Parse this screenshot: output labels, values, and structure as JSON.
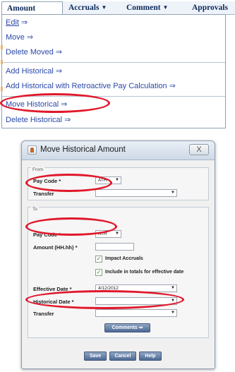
{
  "menubar": {
    "tabs": [
      {
        "label": "Amount",
        "has_caret": false
      },
      {
        "label": "Accruals",
        "caret": "▼"
      },
      {
        "label": "Comment",
        "caret": "▼"
      },
      {
        "label": "Approvals",
        "caret": ""
      }
    ]
  },
  "menu": {
    "arrow": "⇒",
    "items": [
      {
        "label": "Edit"
      },
      {
        "label": "Move"
      },
      {
        "label": "Delete Moved"
      },
      {
        "label": "Add Historical"
      },
      {
        "label": "Add Historical with Retroactive Pay Calculation"
      },
      {
        "label": "Move Historical"
      },
      {
        "label": "Delete Historical"
      }
    ],
    "highlighted_item": "Move Historical"
  },
  "dialog": {
    "title": "Move Historical Amount",
    "close_symbol": "X",
    "from": {
      "legend": "From",
      "pay_code_label": "Pay Code *",
      "pay_code_value": "ATH",
      "transfer_label": "Transfer",
      "transfer_value": ""
    },
    "to": {
      "legend": "To",
      "pay_code_label": "Pay Code *",
      "pay_code_value": "ATH",
      "amount_label": "Amount (HH.hh) *",
      "amount_value": "",
      "impact_accruals_label": "Impact Accruals",
      "impact_accruals_checked": true,
      "include_totals_label": "Include in totals for effective date",
      "include_totals_checked": true,
      "effective_date_label": "Effective Date *",
      "effective_date_value": "4/12/2012",
      "historical_date_label": "Historical Date *",
      "historical_date_value": "",
      "transfer_label": "Transfer",
      "transfer_value": "",
      "comments_button": "Comments ⇒"
    },
    "footer": {
      "save": "Save",
      "cancel": "Cancel",
      "help": "Help"
    }
  },
  "colors": {
    "highlight_ellipse": "#e0182b",
    "menu_link": "#2a48a8",
    "tab_text": "#0d2a5a",
    "button_blue": "#4d6a95",
    "check_green": "#3a8a2a"
  },
  "icons": {
    "dropdown": "▼",
    "checkmark": "✓"
  }
}
